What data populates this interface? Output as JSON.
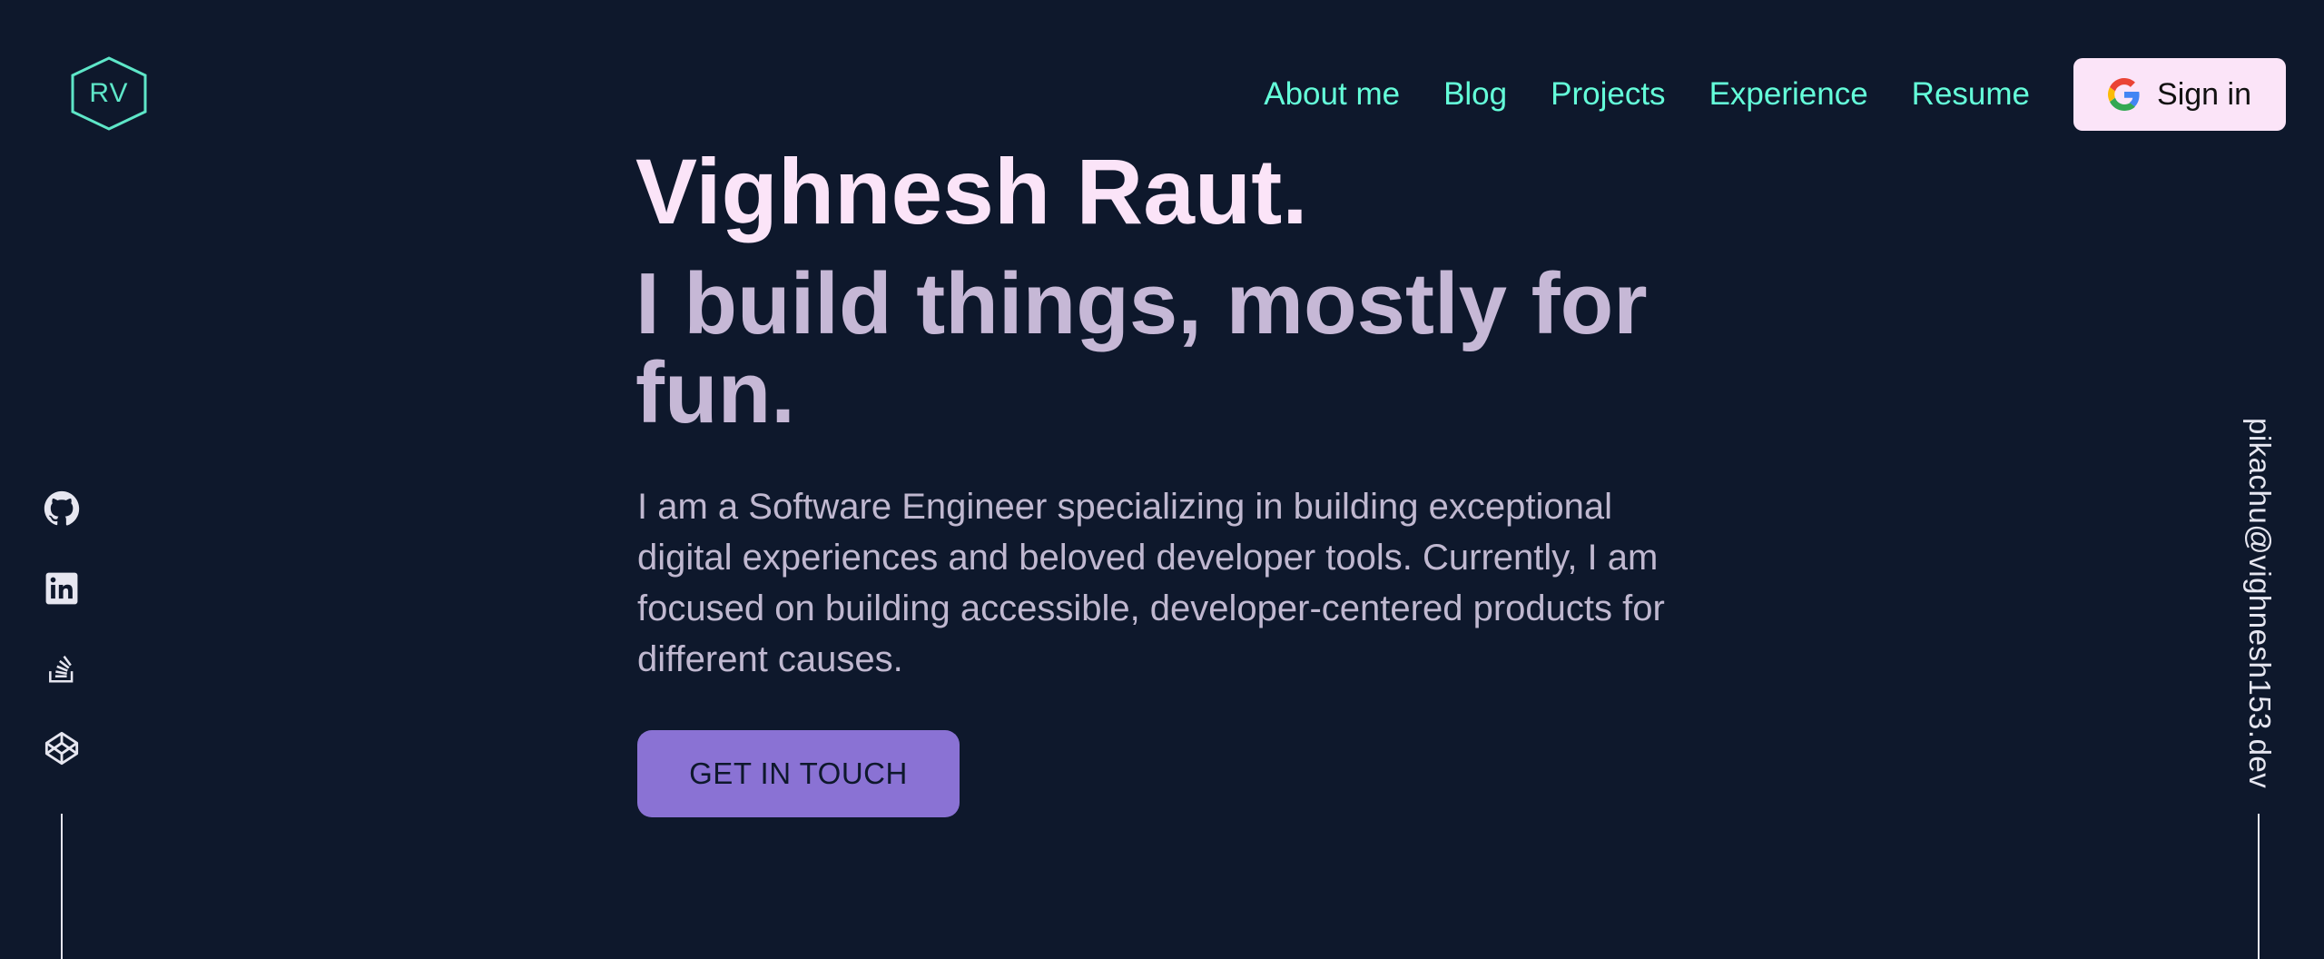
{
  "logo": {
    "text": "RV"
  },
  "nav": {
    "links": [
      "About me",
      "Blog",
      "Projects",
      "Experience",
      "Resume"
    ],
    "signin_label": "Sign in"
  },
  "hero": {
    "name": "Vighnesh Raut.",
    "tagline": "I build things, mostly for fun.",
    "description": "I am a Software Engineer specializing in building exceptional digital experiences and beloved developer tools. Currently, I am focused on building accessible, developer-centered products for different causes.",
    "cta_label": "GET IN TOUCH"
  },
  "social": {
    "icons": [
      "github-icon",
      "linkedin-icon",
      "stackoverflow-icon",
      "codepen-icon"
    ]
  },
  "email": "pikachu@vighnesh153.dev",
  "colors": {
    "background": "#0e182c",
    "accent": "#64ffda",
    "name": "#fbe4f8",
    "tagline": "#c6b8d6",
    "button": "#8a72d4"
  }
}
